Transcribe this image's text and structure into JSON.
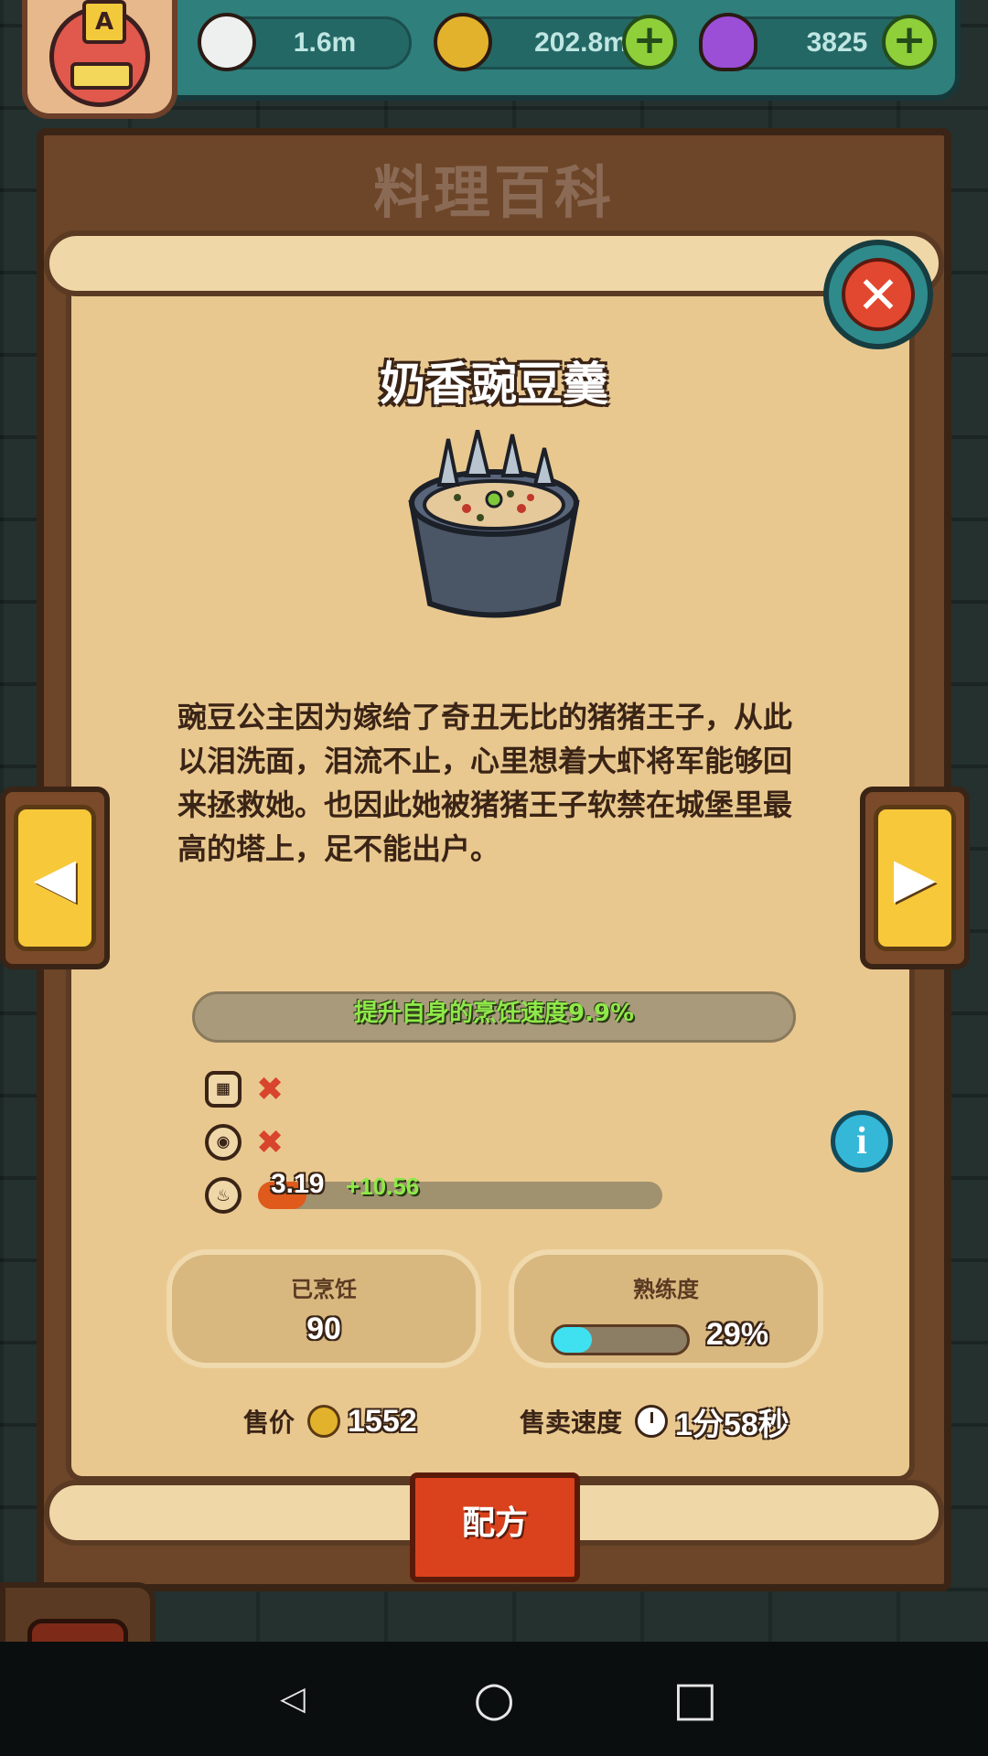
{
  "topbar": {
    "avatar_rank": "A",
    "eye_amount": "1.6m",
    "coin_amount": "202.8m",
    "potion_amount": "3825"
  },
  "board_title": "料理百科",
  "dish": {
    "name": "奶香豌豆羹",
    "description": "豌豆公主因为嫁给了奇丑无比的猪猪王子，从此以泪洗面，泪流不止，心里想着大虾将军能够回来拯救她。也因此她被猪猪王子软禁在城堡里最高的塔上，足不能出户。",
    "bonus": "提升自身的烹饪速度9.9%",
    "fire_value": "3.19",
    "fire_bonus": "+10.56",
    "fire_level": 0.12,
    "cooked_label": "已烹饪",
    "cooked_value": "90",
    "proficiency_label": "熟练度",
    "proficiency_percent": "29%",
    "proficiency_level": 0.29,
    "price_label": "售价",
    "price_value": "1552",
    "sell_speed_label": "售卖速度",
    "sell_speed_value": "1分58秒"
  },
  "buttons": {
    "recipe": "配方",
    "close": "✕",
    "prev": "◀",
    "next": "▶",
    "info": "i",
    "back": "⬅"
  },
  "icons": {
    "grid": "▦",
    "eye": "◉",
    "fire": "♨",
    "x": "✖"
  },
  "system_nav": {
    "back": "◁",
    "home": "○",
    "recents": "□"
  }
}
